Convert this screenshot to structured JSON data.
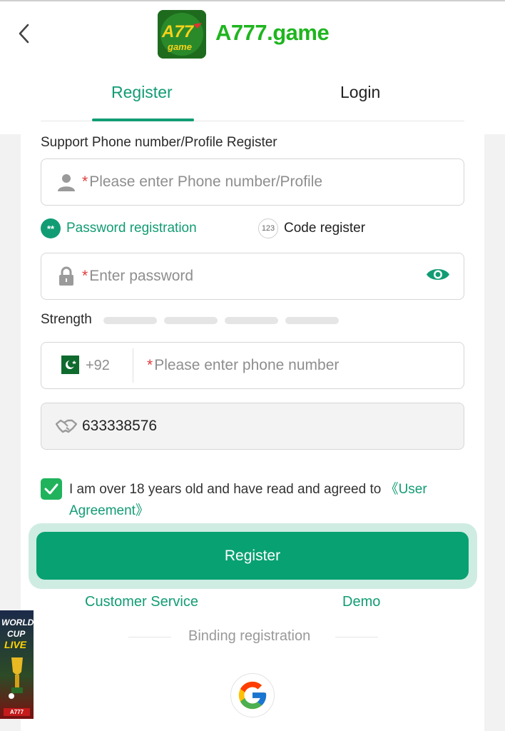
{
  "header": {
    "brand_name": "A777.game",
    "logo_text_top": "A77",
    "logo_text_bottom": "game",
    "back_icon": "chevron-left-icon"
  },
  "tabs": [
    {
      "label": "Register",
      "active": true
    },
    {
      "label": "Login",
      "active": false
    }
  ],
  "form": {
    "profile_label": "Support Phone number/Profile Register",
    "profile_placeholder": "Please enter Phone number/Profile",
    "modes": {
      "password_label": "Password registration",
      "password_badge": "**",
      "code_label": "Code register",
      "code_badge": "123"
    },
    "password_placeholder": "Enter password",
    "strength_label": "Strength",
    "phone_country_code": "+92",
    "phone_placeholder": "Please enter phone number",
    "invite_code": "633338576",
    "required_mark": "*"
  },
  "agreement": {
    "checked": true,
    "text": "I am over 18 years old and have read and agreed to ",
    "link": "《User Agreement》"
  },
  "actions": {
    "register_button": "Register",
    "customer_service": "Customer Service",
    "demo": "Demo",
    "binding_registration": "Binding registration"
  },
  "promo": {
    "line1": "WORLD",
    "line2": "CUP",
    "line3": "LIVE",
    "tag": "A777"
  },
  "colors": {
    "accent": "#129c74",
    "button": "#08a172",
    "checkbox": "#20b35c",
    "brand": "#1fb51f",
    "required": "#e03b3b"
  }
}
